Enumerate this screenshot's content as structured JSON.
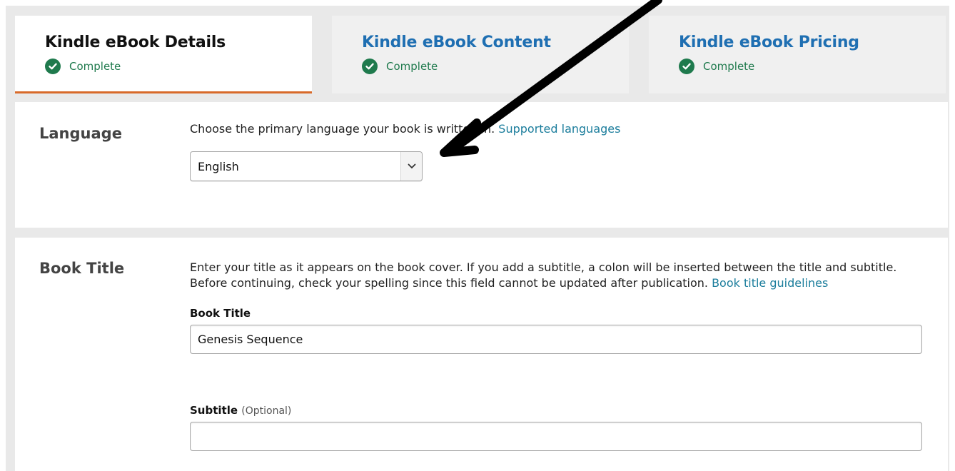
{
  "tabs": [
    {
      "title": "Kindle eBook Details",
      "status": "Complete"
    },
    {
      "title": "Kindle eBook Content",
      "status": "Complete"
    },
    {
      "title": "Kindle eBook Pricing",
      "status": "Complete"
    }
  ],
  "language": {
    "label": "Language",
    "description": "Choose the primary language your book is written in.",
    "link": "Supported languages",
    "selected": "English"
  },
  "book_title": {
    "label": "Book Title",
    "description": "Enter your title as it appears on the book cover. If you add a subtitle, a colon will be inserted between the title and subtitle. Before continuing, check your spelling since this field cannot be updated after publication.",
    "link": "Book title guidelines",
    "field_label": "Book Title",
    "field_value": "Genesis Sequence",
    "subtitle_label": "Subtitle",
    "subtitle_optional": "(Optional)",
    "subtitle_value": ""
  },
  "colors": {
    "active_tab_underline": "#d86a2a",
    "link": "#1b7d9c",
    "tab_link": "#1f6fb2",
    "complete_green": "#1f7a4d"
  }
}
